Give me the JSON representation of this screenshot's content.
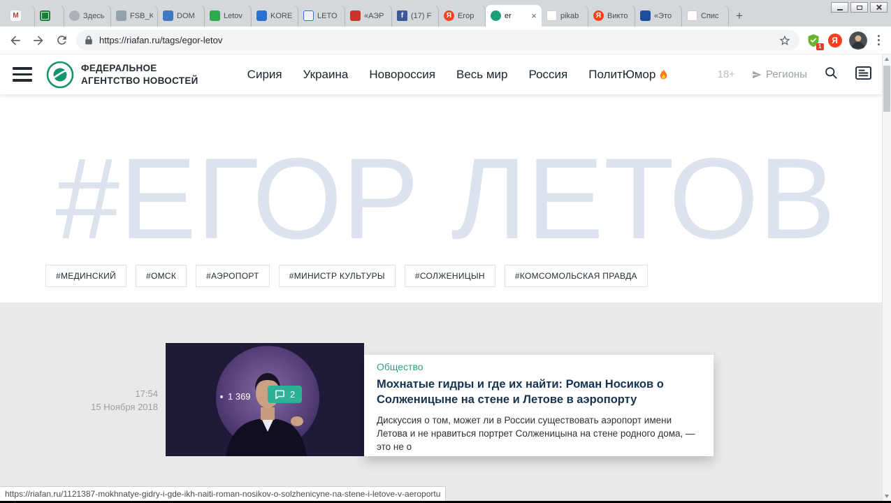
{
  "browser": {
    "tabs": [
      {
        "label": "",
        "glyph": "M"
      },
      {
        "label": "",
        "glyph": ""
      },
      {
        "label": "Здесь",
        "glyph": ""
      },
      {
        "label": "FSB_K",
        "glyph": ""
      },
      {
        "label": "DOM",
        "glyph": ""
      },
      {
        "label": "Letov",
        "glyph": ""
      },
      {
        "label": "KORE",
        "glyph": ""
      },
      {
        "label": "LETO",
        "glyph": ""
      },
      {
        "label": "«АЭР",
        "glyph": ""
      },
      {
        "label": "(17) F",
        "glyph": "f"
      },
      {
        "label": "Егор",
        "glyph": "Я"
      },
      {
        "label": "er",
        "glyph": "",
        "close": "×"
      },
      {
        "label": "pikab",
        "glyph": ""
      },
      {
        "label": "Викто",
        "glyph": "Я"
      },
      {
        "label": "«Это",
        "glyph": ""
      },
      {
        "label": "Спис",
        "glyph": ""
      }
    ],
    "new_tab": "+",
    "url": "https://riafan.ru/tags/egor-letov",
    "extensions": {
      "shield_badge": "1",
      "yandex_glyph": "Я"
    }
  },
  "site_header": {
    "logo_line1": "ФЕДЕРАЛЬНОЕ",
    "logo_line2": "АГЕНТСТВО НОВОСТЕЙ",
    "nav": [
      "Сирия",
      "Украина",
      "Новороссия",
      "Весь мир",
      "Россия",
      "ПолитЮмор"
    ],
    "age": "18+",
    "regions": "Регионы"
  },
  "tag_page": {
    "watermark": "#ЕГОР ЛЕТОВ",
    "tags": [
      "#МЕДИНСКИЙ",
      "#ОМСК",
      "#АЭРОПОРТ",
      "#МИНИСТР КУЛЬТУРЫ",
      "#СОЛЖЕНИЦЫН",
      "#КОМСОМОЛЬСКАЯ ПРАВДА"
    ]
  },
  "article": {
    "time": "17:54",
    "date": "15 Ноября 2018",
    "views": "1 369",
    "comments": "2",
    "category": "Общество",
    "title": "Мохнатые гидры и где их найти: Роман Носиков о Солженицыне на стене и Летове в аэропорту",
    "excerpt": "Дискуссия о том, может ли в России существовать аэропорт имени Летова и не нравиться портрет Солженицына на стене родного дома, — это не о"
  },
  "status_url": "https://riafan.ru/1121387-mokhnatye-gidry-i-gde-ikh-naiti-roman-nosikov-o-solzhenicyne-na-stene-i-letove-v-aeroportu",
  "colors": {
    "accent_teal": "#2db197",
    "category_green": "#2aa084",
    "watermark_blue": "#dce3ee",
    "yandex_red": "#fc3f1d",
    "fan_green": "#14946c"
  }
}
